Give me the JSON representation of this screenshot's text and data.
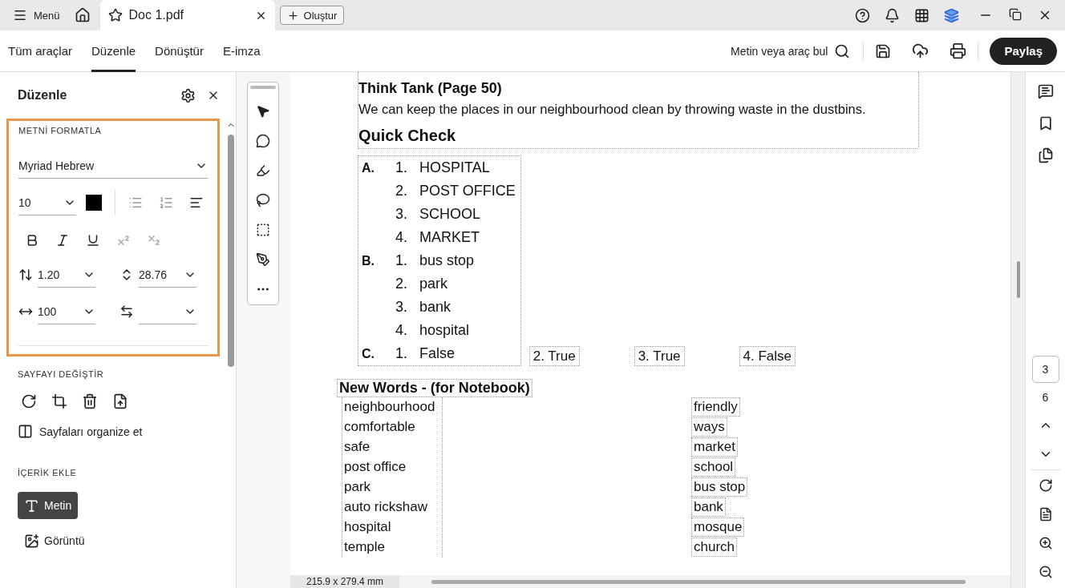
{
  "title_bar": {
    "menu": "Menü",
    "tab": {
      "title": "Doc 1.pdf"
    },
    "create": "Oluştur"
  },
  "toolbar": {
    "tabs": [
      {
        "label": "Tüm araçlar",
        "selected": false
      },
      {
        "label": "Düzenle",
        "selected": true
      },
      {
        "label": "Dönüştür",
        "selected": false
      },
      {
        "label": "E-imza",
        "selected": false
      }
    ],
    "search": "Metin veya araç bul",
    "share": "Paylaş"
  },
  "panel": {
    "title": "Düzenle",
    "format": {
      "heading": "METNİ FORMATLA",
      "font": "Myriad Hebrew",
      "size": "10",
      "color": "#000000",
      "line_spacing": "1.20",
      "paragraph_spacing": "28.76",
      "scale": "100"
    },
    "page_section": {
      "heading": "SAYFAYI DEĞİŞTİR",
      "organize": "Sayfaları organize et"
    },
    "content_section": {
      "heading": "İÇERİK EKLE",
      "items": [
        {
          "label": "Metin",
          "selected": true
        },
        {
          "label": "Görüntü",
          "selected": false
        }
      ]
    }
  },
  "document": {
    "think_tank": {
      "heading": "Think Tank (Page 50)",
      "text": "We can keep the places in our neighbourhood clean by throwing waste in the dustbins."
    },
    "quick_check": {
      "heading": "Quick Check",
      "groups": [
        {
          "letter": "A.",
          "kind": "stacked",
          "items": [
            {
              "number": "1.",
              "text": "HOSPITAL"
            },
            {
              "number": "2.",
              "text": "POST OFFICE"
            },
            {
              "number": "3.",
              "text": "SCHOOL"
            },
            {
              "number": "4.",
              "text": "MARKET"
            }
          ]
        },
        {
          "letter": "B.",
          "kind": "stacked",
          "items": [
            {
              "number": "1.",
              "text": "bus stop"
            },
            {
              "number": "2.",
              "text": "park"
            },
            {
              "number": "3.",
              "text": "bank"
            },
            {
              "number": "4.",
              "text": "hospital"
            }
          ]
        },
        {
          "letter": "C.",
          "kind": "inline",
          "items": [
            {
              "number": "1.",
              "text": "False"
            },
            {
              "number": "2.",
              "text": "True"
            },
            {
              "number": "3.",
              "text": "True"
            },
            {
              "number": "4.",
              "text": "False"
            }
          ]
        }
      ]
    },
    "new_words": {
      "heading": "New Words - (for Notebook)",
      "column_1": [
        "neighbourhood",
        "comfortable",
        "safe",
        "post office",
        "park",
        "auto rickshaw",
        "hospital",
        "temple"
      ],
      "column_2": [
        "friendly",
        "ways",
        "market",
        "school",
        "bus stop",
        "bank",
        "mosque",
        "church"
      ]
    }
  },
  "page_size": "215.9 x 279.4 mm",
  "page_nav": {
    "current": "3",
    "total": "6"
  }
}
